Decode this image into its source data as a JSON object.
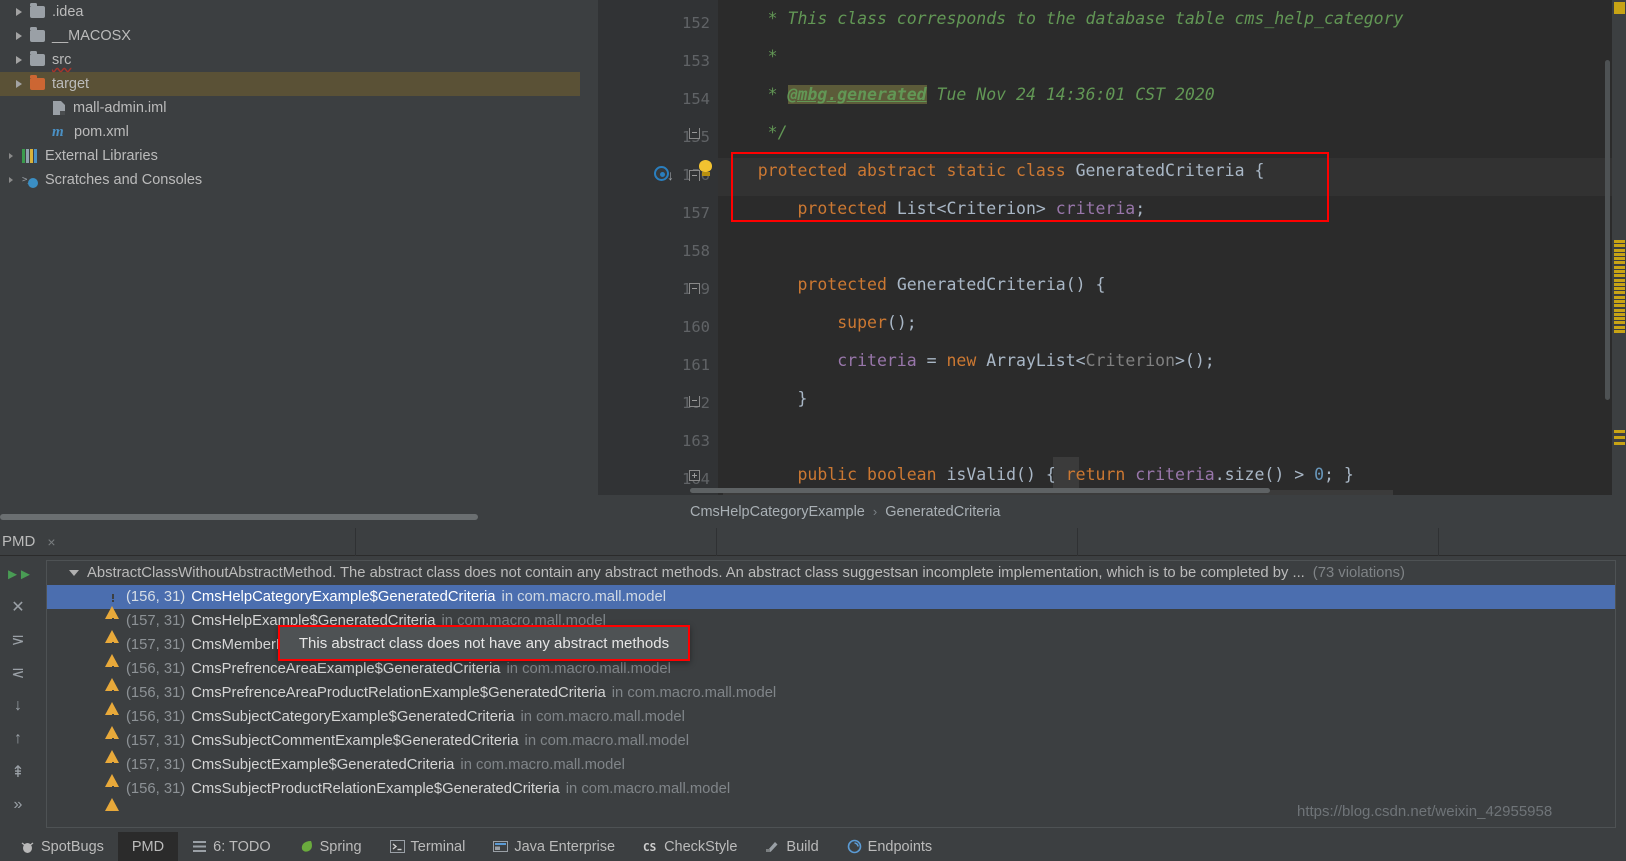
{
  "project_tree": {
    "items": [
      {
        "label": ".idea",
        "icon": "folder-icon",
        "expandable": true,
        "selected": false,
        "indent": 1
      },
      {
        "label": "__MACOSX",
        "icon": "folder-icon",
        "expandable": true,
        "selected": false,
        "indent": 1
      },
      {
        "label": "src",
        "icon": "folder-icon",
        "expandable": true,
        "selected": false,
        "indent": 1,
        "error": true
      },
      {
        "label": "target",
        "icon": "folder-orange-icon",
        "expandable": true,
        "selected": true,
        "indent": 1
      },
      {
        "label": "mall-admin.iml",
        "icon": "iml-file-icon",
        "expandable": false,
        "selected": false,
        "indent": 2
      },
      {
        "label": "pom.xml",
        "icon": "maven-icon",
        "expandable": false,
        "selected": false,
        "indent": 2
      },
      {
        "label": "External Libraries",
        "icon": "libraries-icon",
        "expandable": true,
        "selected": false,
        "indent": 0
      },
      {
        "label": "Scratches and Consoles",
        "icon": "scratches-icon",
        "expandable": true,
        "selected": false,
        "indent": 0
      }
    ]
  },
  "editor": {
    "lines": [
      {
        "number": "152",
        "tokens": [
          {
            "text": "     * This class corresponds to the database table cms_help_category",
            "cls": "cmt"
          }
        ]
      },
      {
        "number": "153",
        "tokens": [
          {
            "text": "     *",
            "cls": "cmt"
          }
        ]
      },
      {
        "number": "154",
        "tokens": [
          {
            "text": "     * ",
            "cls": "cmt"
          },
          {
            "text": "@mbg.generated",
            "cls": "cmt-tag"
          },
          {
            "text": " Tue Nov 24 14:36:01 CST 2020",
            "cls": "cmt"
          }
        ]
      },
      {
        "number": "155",
        "tokens": [
          {
            "text": "     */",
            "cls": "cmt"
          }
        ]
      },
      {
        "number": "156",
        "tokens": [
          {
            "text": "    protected abstract static class ",
            "cls": "kw"
          },
          {
            "text": "GeneratedCriteria ",
            "cls": "cls"
          },
          {
            "text": "{",
            "cls": "plain"
          }
        ]
      },
      {
        "number": "157",
        "tokens": [
          {
            "text": "        protected ",
            "cls": "kw"
          },
          {
            "text": "List<Criterion> ",
            "cls": "cls"
          },
          {
            "text": "criteria",
            "cls": "fld"
          },
          {
            "text": ";",
            "cls": "plain"
          }
        ]
      },
      {
        "number": "158",
        "tokens": []
      },
      {
        "number": "159",
        "tokens": [
          {
            "text": "        protected ",
            "cls": "kw"
          },
          {
            "text": "GeneratedCriteria",
            "cls": "cls"
          },
          {
            "text": "() {",
            "cls": "plain"
          }
        ]
      },
      {
        "number": "160",
        "tokens": [
          {
            "text": "            super",
            "cls": "kw"
          },
          {
            "text": "();",
            "cls": "plain"
          }
        ]
      },
      {
        "number": "161",
        "tokens": [
          {
            "text": "            criteria ",
            "cls": "fld"
          },
          {
            "text": "= ",
            "cls": "plain"
          },
          {
            "text": "new ",
            "cls": "kw"
          },
          {
            "text": "ArrayList<",
            "cls": "cls"
          },
          {
            "text": "Criterion",
            "cls": "gray"
          },
          {
            "text": ">();",
            "cls": "cls"
          }
        ]
      },
      {
        "number": "162",
        "tokens": [
          {
            "text": "        }",
            "cls": "plain"
          }
        ]
      },
      {
        "number": "163",
        "tokens": []
      },
      {
        "number": "164",
        "tokens": [
          {
            "text": "        public boolean ",
            "cls": "kw"
          },
          {
            "text": "isValid",
            "cls": "cls"
          },
          {
            "text": "() { ",
            "cls": "plain"
          },
          {
            "text": "return ",
            "cls": "kw"
          },
          {
            "text": "criteria",
            "cls": "fld"
          },
          {
            "text": ".size() > ",
            "cls": "plain"
          },
          {
            "text": "0",
            "cls": "num"
          },
          {
            "text": "; }",
            "cls": "plain"
          }
        ]
      }
    ],
    "breadcrumb": {
      "parts": [
        "CmsHelpCategoryExample",
        "GeneratedCriteria"
      ],
      "separator": "›"
    }
  },
  "pmd": {
    "tab_label": "PMD",
    "close_label": "×",
    "toolbar_icons": [
      "expand-all-icon",
      "close-icon",
      "collapse-icon",
      "expand-icon",
      "next-occurrence-icon",
      "previous-occurrence-icon",
      "export-icon",
      "more-icon"
    ],
    "group": {
      "text": "AbstractClassWithoutAbstractMethod. The abstract class does not contain any abstract methods. An abstract class suggestsan incomplete implementation, which is to be completed by ...",
      "violations": "(73 violations)"
    },
    "violations": [
      {
        "loc": "(156, 31)",
        "name": "CmsHelpCategoryExample$GeneratedCriteria",
        "pkg": "in com.macro.mall.model",
        "selected": true
      },
      {
        "loc": "(157, 31)",
        "name": "CmsHelpExample$GeneratedCriteria",
        "pkg": "in com.macro.mall.model",
        "selected": false
      },
      {
        "loc": "(157, 31)",
        "name": "CmsMemberReportExample$GeneratedCriteria",
        "pkg": "in com.macro.mall.model",
        "selected": false
      },
      {
        "loc": "(156, 31)",
        "name": "CmsPrefrenceAreaExample$GeneratedCriteria",
        "pkg": "in com.macro.mall.model",
        "selected": false
      },
      {
        "loc": "(156, 31)",
        "name": "CmsPrefrenceAreaProductRelationExample$GeneratedCriteria",
        "pkg": "in com.macro.mall.model",
        "selected": false
      },
      {
        "loc": "(156, 31)",
        "name": "CmsSubjectCategoryExample$GeneratedCriteria",
        "pkg": "in com.macro.mall.model",
        "selected": false
      },
      {
        "loc": "(157, 31)",
        "name": "CmsSubjectCommentExample$GeneratedCriteria",
        "pkg": "in com.macro.mall.model",
        "selected": false
      },
      {
        "loc": "(157, 31)",
        "name": "CmsSubjectExample$GeneratedCriteria",
        "pkg": "in com.macro.mall.model",
        "selected": false
      },
      {
        "loc": "(156, 31)",
        "name": "CmsSubjectProductRelationExample$GeneratedCriteria",
        "pkg": "in com.macro.mall.model",
        "selected": false
      }
    ],
    "tooltip": "This abstract class does not have any abstract methods"
  },
  "watermark": "https://blog.csdn.net/weixin_42955958",
  "statusbar": {
    "items": [
      {
        "label": "SpotBugs",
        "icon": "spotbugs-icon",
        "active": false
      },
      {
        "label": "PMD",
        "icon": "pmd-icon",
        "active": true
      },
      {
        "label": "6: TODO",
        "icon": "todo-icon",
        "active": false
      },
      {
        "label": "Spring",
        "icon": "spring-icon",
        "active": false
      },
      {
        "label": "Terminal",
        "icon": "terminal-icon",
        "active": false
      },
      {
        "label": "Java Enterprise",
        "icon": "java-enterprise-icon",
        "active": false
      },
      {
        "label": "CheckStyle",
        "icon": "checkstyle-icon",
        "active": false
      },
      {
        "label": "Build",
        "icon": "build-icon",
        "active": false
      },
      {
        "label": "Endpoints",
        "icon": "endpoints-icon",
        "active": false
      }
    ]
  },
  "colors": {
    "accent_selection": "#4b6eaf",
    "warning": "#e8a93a",
    "error_box": "#ff0000",
    "editor_bg": "#2b2b2b",
    "panel_bg": "#3c3f41"
  }
}
